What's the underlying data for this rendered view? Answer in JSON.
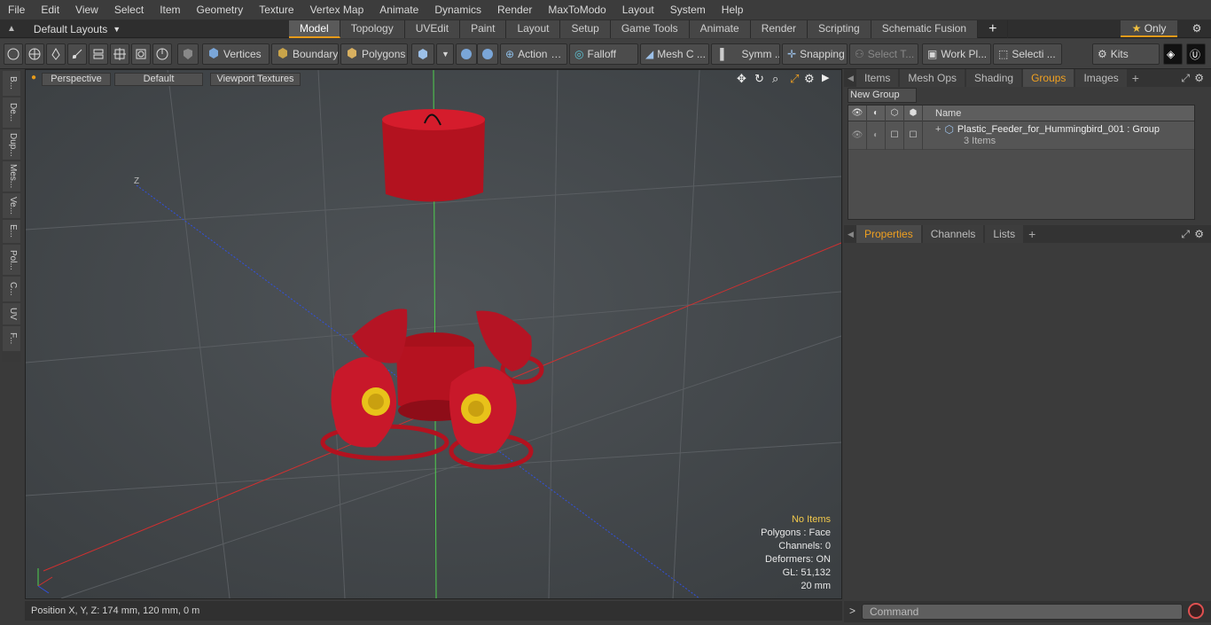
{
  "menu": [
    "File",
    "Edit",
    "View",
    "Select",
    "Item",
    "Geometry",
    "Texture",
    "Vertex Map",
    "Animate",
    "Dynamics",
    "Render",
    "MaxToModo",
    "Layout",
    "System",
    "Help"
  ],
  "layout_dropdown": "Default Layouts",
  "tabs": [
    "Model",
    "Topology",
    "UVEdit",
    "Paint",
    "Layout",
    "Setup",
    "Game Tools",
    "Animate",
    "Render",
    "Scripting",
    "Schematic Fusion"
  ],
  "active_tab": "Model",
  "only_label": "Only",
  "toolbar": {
    "vertices": "Vertices",
    "boundary": "Boundary",
    "polygons": "Polygons",
    "action": "Action",
    "falloff": "Falloff",
    "mesh": "Mesh C ...",
    "symm": "Symm ...",
    "snapping": "Snapping",
    "select_t": "Select T...",
    "work_pl": "Work Pl...",
    "selecti": "Selecti ...",
    "kits": "Kits"
  },
  "left_tabs": [
    "B...",
    "De...",
    "Dup...",
    "Mes...",
    "Ve...",
    "E...",
    "Pol...",
    "C...",
    "UV",
    "F..."
  ],
  "viewport": {
    "view": "Perspective",
    "shading": "Default",
    "textures": "Viewport Textures",
    "axis_label": "Z"
  },
  "stats": {
    "items": "No Items",
    "polygons": "Polygons : Face",
    "channels": "Channels: 0",
    "deformers": "Deformers: ON",
    "gl": "GL: 51,132",
    "scale": "20 mm"
  },
  "status": "Position X, Y, Z:   174 mm, 120 mm, 0 m",
  "right_tabs_top": [
    "Items",
    "Mesh Ops",
    "Shading",
    "Groups",
    "Images"
  ],
  "right_tabs_top_active": "Groups",
  "new_group": "New Group",
  "group_header": "Name",
  "group": {
    "name": "Plastic_Feeder_for_Hummingbird_001 : Group",
    "count": "3 Items"
  },
  "right_tabs_bottom": [
    "Properties",
    "Channels",
    "Lists"
  ],
  "right_tabs_bottom_active": "Properties",
  "command_placeholder": "Command",
  "colors": {
    "accent": "#e69a1a",
    "feeder_red": "#c0182a",
    "flower_yellow": "#e8c21a"
  }
}
